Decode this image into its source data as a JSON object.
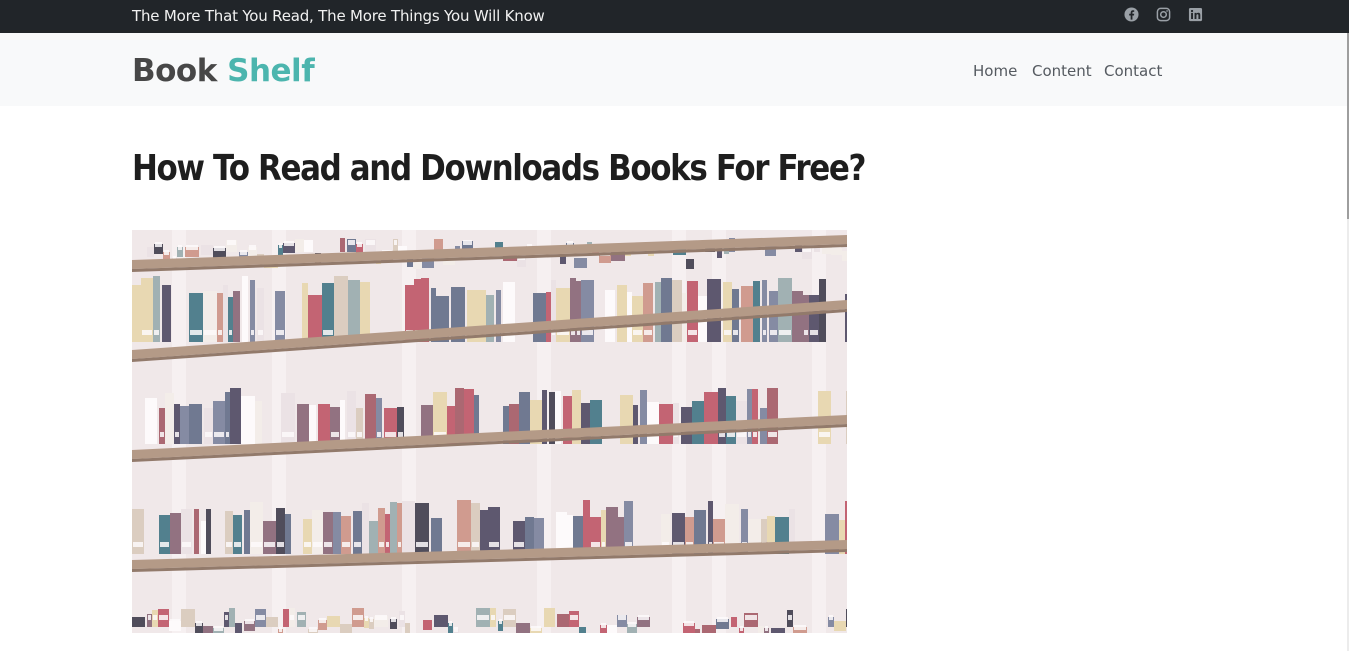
{
  "topbar": {
    "tagline": "The More That You Read, The More Things You Will Know",
    "social": [
      "facebook-icon",
      "instagram-icon",
      "linkedin-icon"
    ]
  },
  "navbar": {
    "brand_part1": "Book",
    "brand_part2": "Shelf",
    "links": [
      "Home",
      "Content",
      "Contact"
    ]
  },
  "article": {
    "title": "How To Read and Downloads Books For Free?",
    "image": "bookshelf-photo"
  },
  "colors": {
    "topbar_bg": "#212529",
    "navbar_bg": "#f8f9fa",
    "brand_accent": "#4cb5ae",
    "brand_dark": "#474747"
  }
}
